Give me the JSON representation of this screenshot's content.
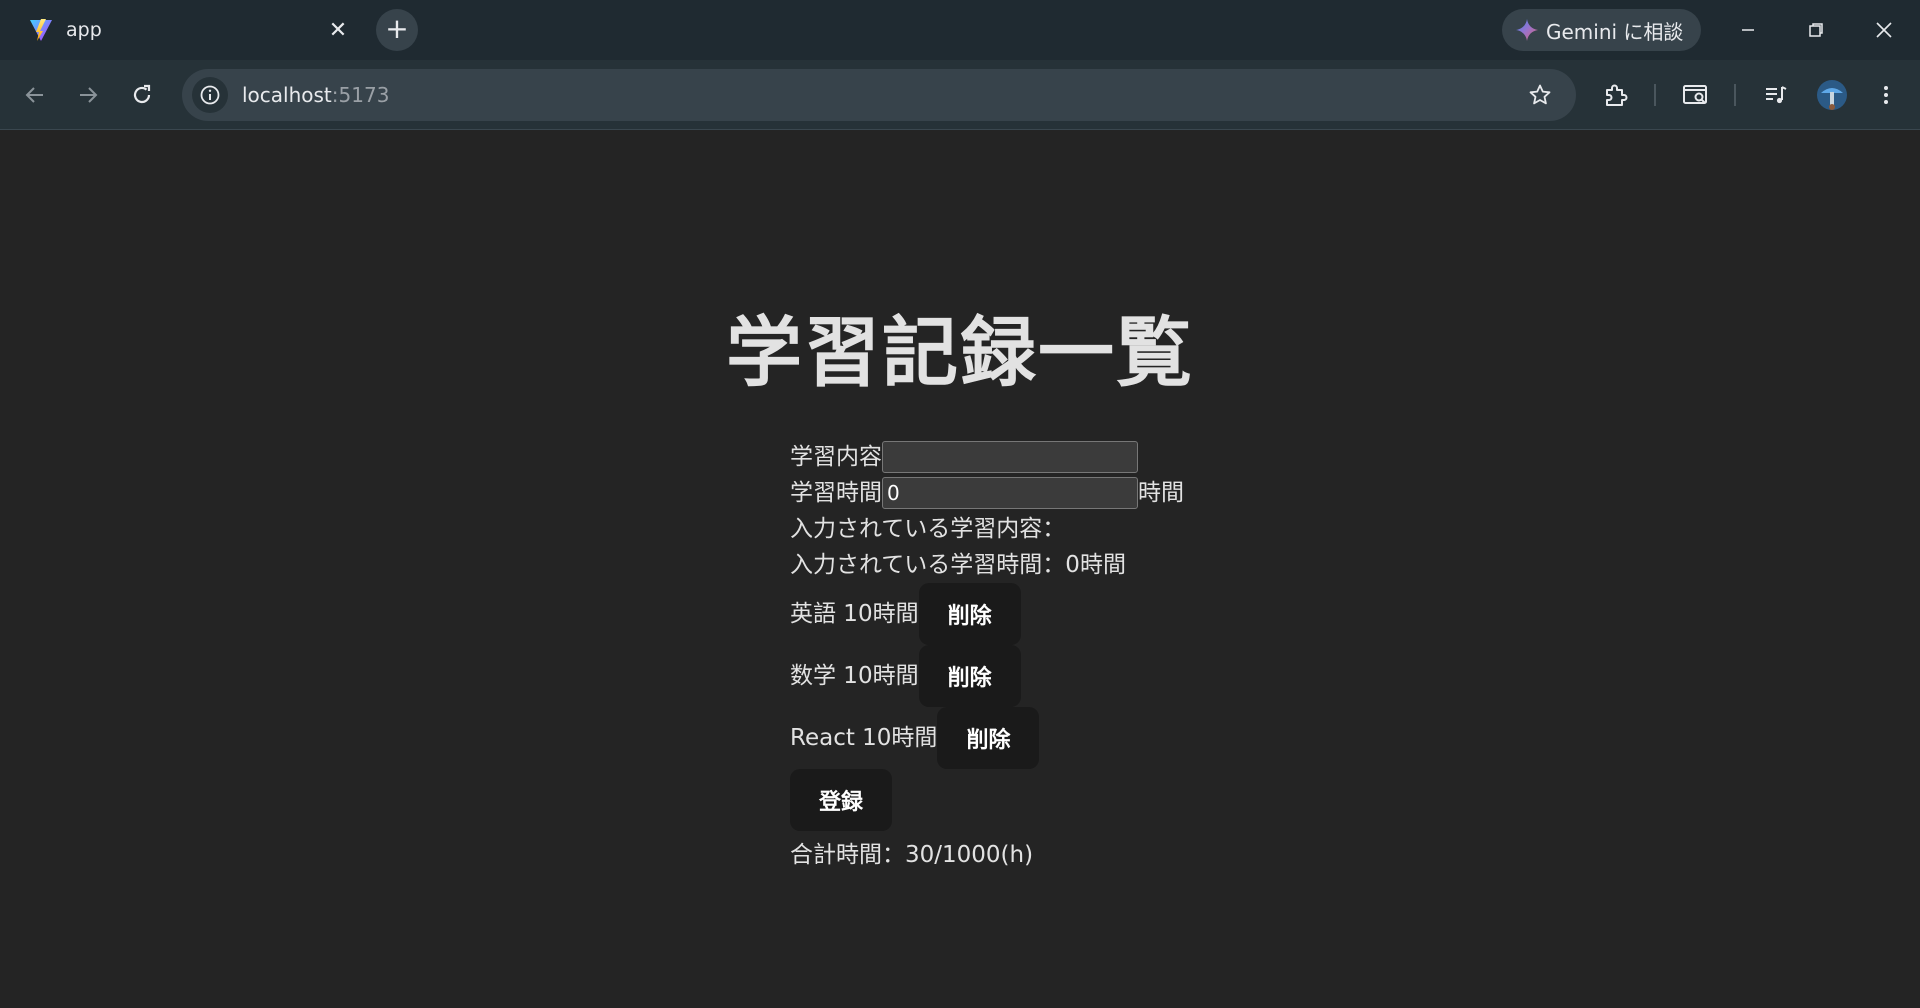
{
  "browser": {
    "tab_title": "app",
    "gemini_label": "Gemini に相談",
    "url_host": "localhost",
    "url_port": ":5173"
  },
  "page": {
    "title": "学習記録一覧",
    "content_label": "学習内容",
    "content_value": "",
    "time_label": "学習時間",
    "time_value": "0",
    "time_unit": "時間",
    "entered_content_label": "入力されている学習内容：",
    "entered_time_label": "入力されている学習時間：0時間",
    "records": [
      {
        "text": "英語 10時間",
        "delete_label": "削除"
      },
      {
        "text": "数学 10時間",
        "delete_label": "削除"
      },
      {
        "text": "React 10時間",
        "delete_label": "削除"
      }
    ],
    "register_label": "登録",
    "total_label": "合計時間：30/1000(h)"
  }
}
